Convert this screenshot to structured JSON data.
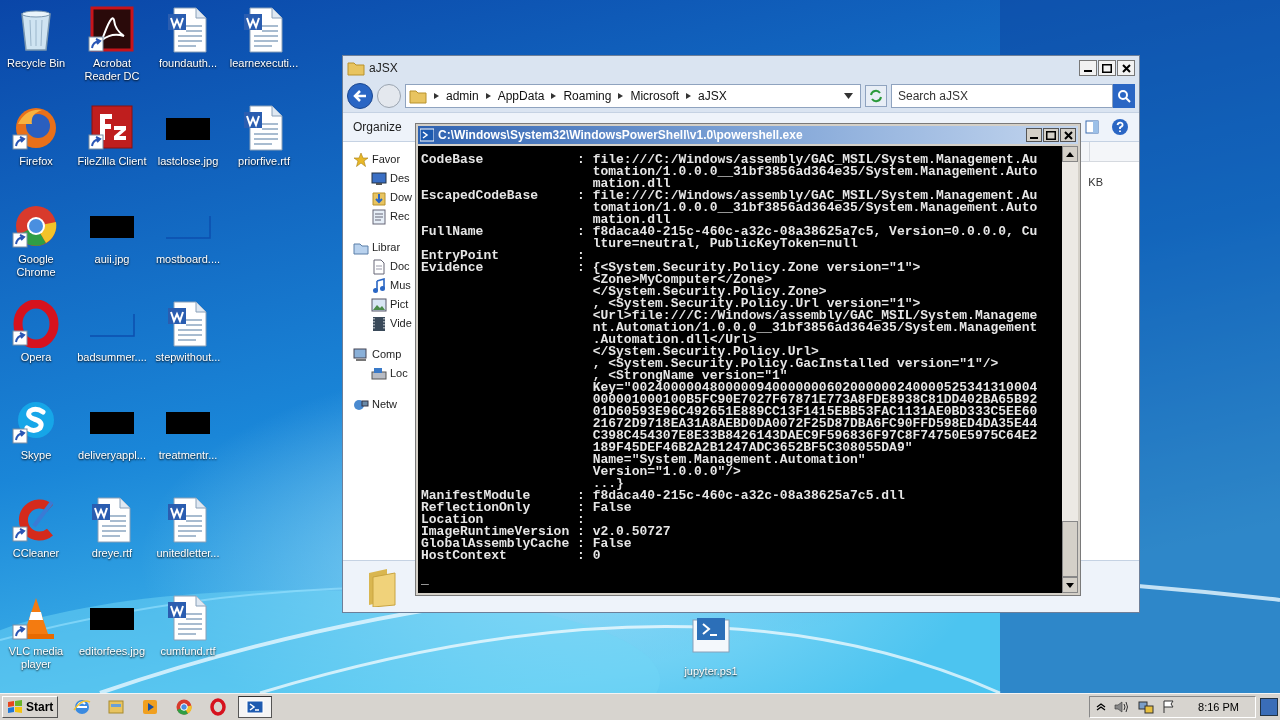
{
  "desktop": {
    "icon_columns": [
      [
        {
          "label": "Recycle Bin",
          "kind": "recycle-bin",
          "shortcut": false
        },
        {
          "label": "Firefox",
          "kind": "firefox",
          "shortcut": true
        },
        {
          "label": "Google Chrome",
          "kind": "chrome",
          "shortcut": true
        },
        {
          "label": "Opera",
          "kind": "opera",
          "shortcut": true
        },
        {
          "label": "Skype",
          "kind": "skype",
          "shortcut": true
        },
        {
          "label": "CCleaner",
          "kind": "ccleaner",
          "shortcut": true
        },
        {
          "label": "VLC media player",
          "kind": "vlc",
          "shortcut": true
        }
      ],
      [
        {
          "label": "Acrobat Reader DC",
          "kind": "acrobat",
          "shortcut": true
        },
        {
          "label": "FileZilla Client",
          "kind": "filezilla",
          "shortcut": true
        },
        {
          "label": "auii.jpg",
          "shortcut": false
        },
        {
          "label": "badsummer....",
          "kind": "image-blank",
          "shortcut": false
        },
        {
          "label": "deliveryappl...",
          "shortcut": false
        },
        {
          "label": "dreye.rtf",
          "kind": "word",
          "shortcut": false
        },
        {
          "label": "editorfees.jpg",
          "shortcut": false
        }
      ],
      [
        {
          "label": "foundauth...",
          "kind": "word",
          "shortcut": false
        },
        {
          "label": "lastclose.jpg",
          "shortcut": false
        },
        {
          "label": "mostboard....",
          "kind": "image-blank",
          "shortcut": false
        },
        {
          "label": "stepwithout...",
          "kind": "word",
          "shortcut": false
        },
        {
          "label": "treatmentr...",
          "shortcut": false
        },
        {
          "label": "unitedletter...",
          "kind": "word",
          "shortcut": false
        },
        {
          "label": "cumfund.rtf",
          "kind": "word",
          "shortcut": false
        }
      ],
      [
        {
          "label": "learnexecuti...",
          "kind": "word",
          "shortcut": false
        },
        {
          "label": "priorfive.rtf",
          "kind": "word",
          "shortcut": false
        }
      ]
    ],
    "loose_icons": [
      {
        "label": "jupyter.ps1",
        "kind": "script",
        "shortcut": false
      }
    ]
  },
  "explorer": {
    "title": "aJSX",
    "breadcrumbs": [
      "admin",
      "AppData",
      "Roaming",
      "Microsoft",
      "aJSX"
    ],
    "search": {
      "placeholder": "Search aJSX"
    },
    "toolbar": [
      "Organize"
    ],
    "navigation": [
      {
        "label": "Favor",
        "kind": "star",
        "children": [
          {
            "label": "Des",
            "kind": "desktop"
          },
          {
            "label": "Dow",
            "kind": "downloads"
          },
          {
            "label": "Rec",
            "kind": "recent"
          }
        ]
      },
      {
        "label": "Librar",
        "kind": "library",
        "children": [
          {
            "label": "Doc",
            "kind": "documents"
          },
          {
            "label": "Mus",
            "kind": "music"
          },
          {
            "label": "Pict",
            "kind": "pictures"
          },
          {
            "label": "Vide",
            "kind": "videos"
          }
        ]
      },
      {
        "label": "Comp",
        "kind": "computer",
        "children": [
          {
            "label": "Loc",
            "kind": "disk"
          }
        ]
      },
      {
        "label": "Netw",
        "kind": "network"
      }
    ],
    "file_size_fragment": "KB"
  },
  "console": {
    "title": "C:\\Windows\\System32\\WindowsPowerShell\\v1.0\\powershell.exe",
    "lines": [
      "CodeBase            : file:///C:/Windows/assembly/GAC_MSIL/System.Management.Au",
      "                      tomation/1.0.0.0__31bf3856ad364e35/System.Management.Auto",
      "                      mation.dll",
      "EscapedCodeBase     : file:///C:/Windows/assembly/GAC_MSIL/System.Management.Au",
      "                      tomation/1.0.0.0__31bf3856ad364e35/System.Management.Auto",
      "                      mation.dll",
      "FullName            : f8daca40-215c-460c-a32c-08a38625a7c5, Version=0.0.0.0, Cu",
      "                      lture=neutral, PublicKeyToken=null",
      "EntryPoint          :",
      "Evidence            : {<System.Security.Policy.Zone version=\"1\">",
      "                      <Zone>MyComputer</Zone>",
      "                      </System.Security.Policy.Zone>",
      "                      , <System.Security.Policy.Url version=\"1\">",
      "                      <Url>file:///C:/Windows/assembly/GAC_MSIL/System.Manageme",
      "                      nt.Automation/1.0.0.0__31bf3856ad364e35/System.Management",
      "                      .Automation.dll</Url>",
      "                      </System.Security.Policy.Url>",
      "                      , <System.Security.Policy.GacInstalled version=\"1\"/>",
      "                      , <StrongName version=\"1\"",
      "                      Key=\"0024000004800000940000000602000000240000525341310004",
      "                      000001000100B5FC90E7027F67871E773A8FDE8938C81DD402BA65B92",
      "                      01D60593E96C492651E889CC13F1415EBB53FAC1131AE0BD333C5EE60",
      "                      21672D9718EA31A8AEBD0DA0072F25D87DBA6FC90FFD598ED4DA35E44",
      "                      C398C454307E8E33B8426143DAEC9F596836F97C8F74750E5975C64E2",
      "                      189F45DEF46B2A2B1247ADC3652BF5C308055DA9\"",
      "                      Name=\"System.Management.Automation\"",
      "                      Version=\"1.0.0.0\"/>",
      "                      ...}",
      "ManifestModule      : f8daca40-215c-460c-a32c-08a38625a7c5.dll",
      "ReflectionOnly      : False",
      "Location            :",
      "ImageRuntimeVersion : v2.0.50727",
      "GlobalAssemblyCache : False",
      "HostContext         : 0"
    ],
    "cursor": "_"
  },
  "taskbar": {
    "start": "Start",
    "items": [
      {
        "kind": "ie",
        "active": false
      },
      {
        "kind": "explorer",
        "active": false
      },
      {
        "kind": "media",
        "active": false
      },
      {
        "kind": "chrome",
        "active": false
      },
      {
        "kind": "opera",
        "active": false
      },
      {
        "kind": "powershell",
        "active": true
      }
    ],
    "clock": "8:16 PM"
  }
}
